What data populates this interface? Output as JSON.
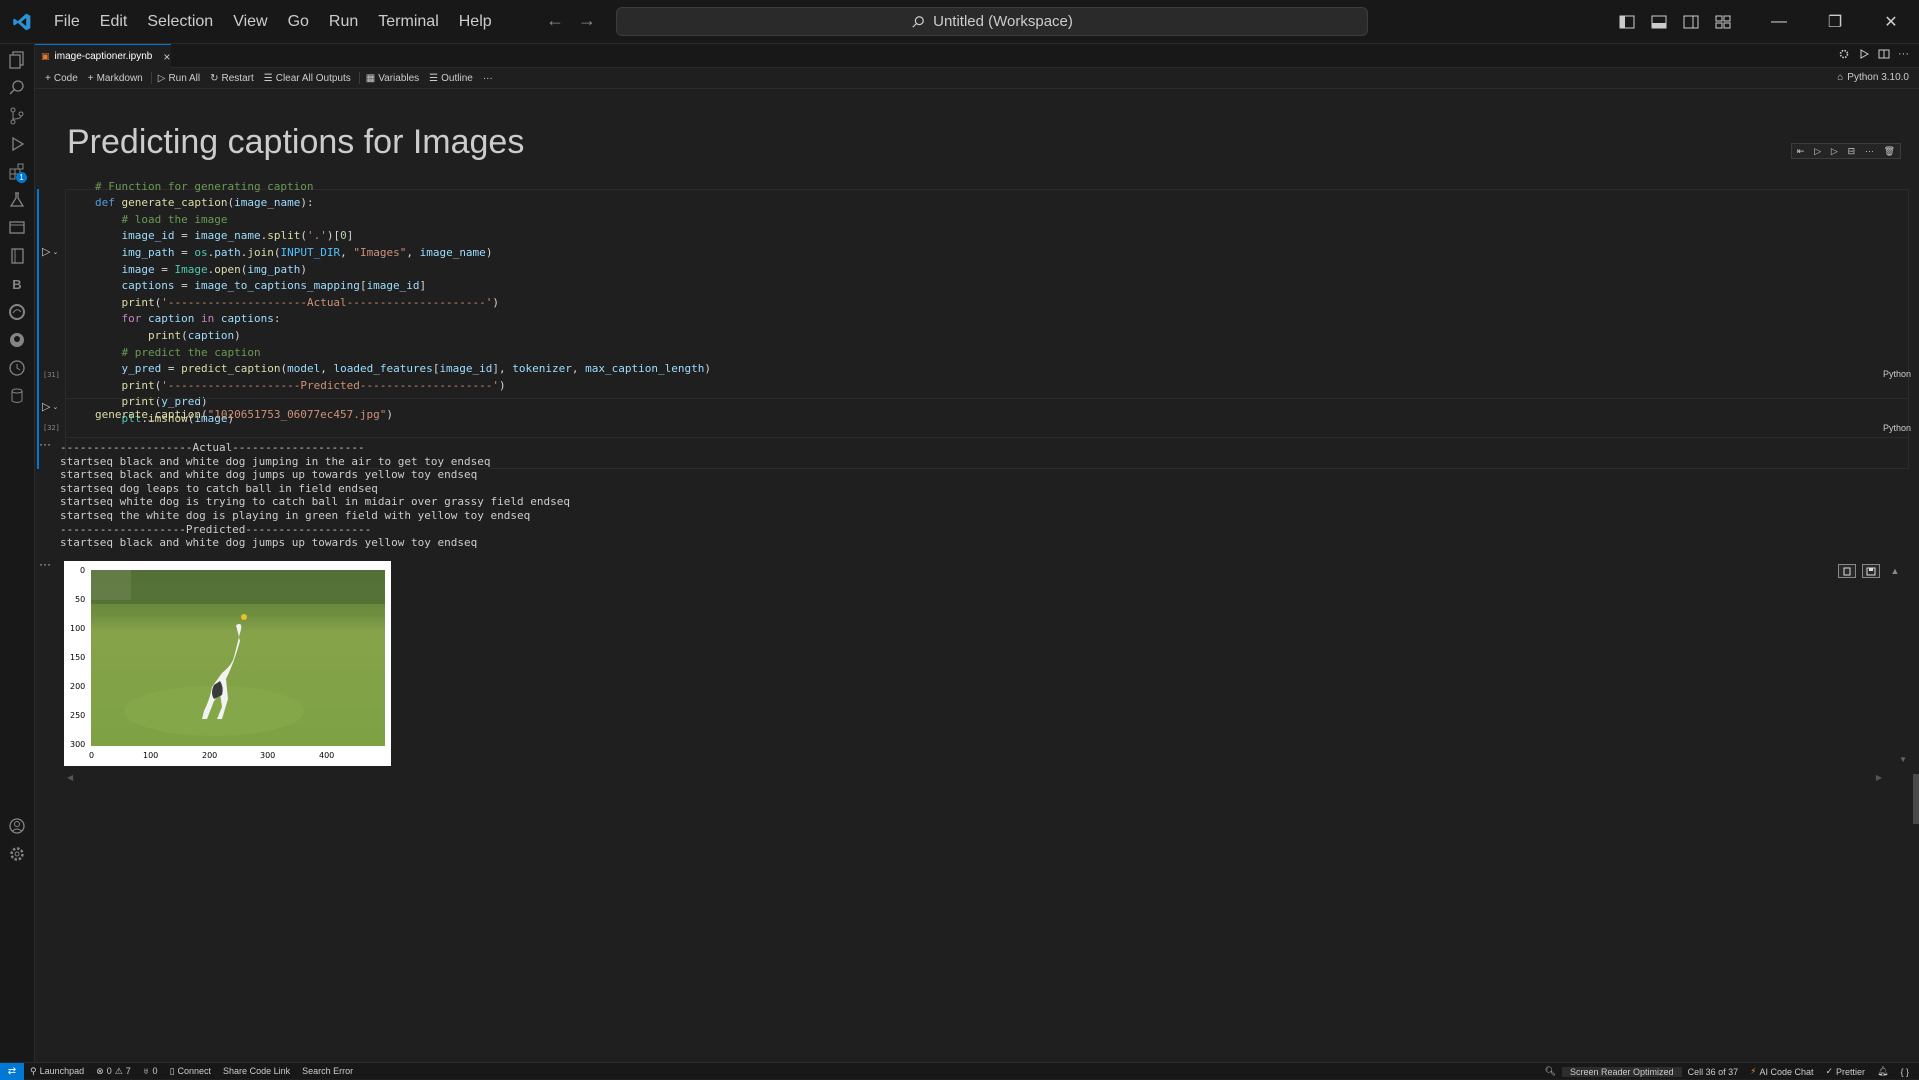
{
  "menu": [
    "File",
    "Edit",
    "Selection",
    "View",
    "Go",
    "Run",
    "Terminal",
    "Help"
  ],
  "command_center": {
    "text": "Untitled (Workspace)"
  },
  "tab": {
    "label": "image-captioner.ipynb"
  },
  "toolbar": {
    "code": "Code",
    "markdown": "Markdown",
    "run_all": "Run All",
    "restart": "Restart",
    "clear_outputs": "Clear All Outputs",
    "variables": "Variables",
    "outline": "Outline",
    "kernel": "Python 3.10.0"
  },
  "notebook": {
    "heading": "Predicting captions for Images",
    "cell1": {
      "exec_count": "[31]",
      "language": "Python",
      "lines": [
        "# Function for generating caption",
        "def generate_caption(image_name):",
        "    # load the image",
        "    image_id = image_name.split('.')[0]",
        "    img_path = os.path.join(INPUT_DIR, \"Images\", image_name)",
        "    image = Image.open(img_path)",
        "    captions = image_to_captions_mapping[image_id]",
        "    print('---------------------Actual---------------------')",
        "    for caption in captions:",
        "        print(caption)",
        "    # predict the caption",
        "    y_pred = predict_caption(model, loaded_features[image_id], tokenizer, max_caption_length)",
        "    print('--------------------Predicted--------------------')",
        "    print(y_pred)",
        "    plt.imshow(image)"
      ]
    },
    "cell2": {
      "exec_count": "[32]",
      "language": "Python",
      "code": "generate_caption(\"1020651753_06077ec457.jpg\")"
    },
    "output_lines": [
      "--------------------Actual--------------------",
      "startseq black and white dog jumping in the air to get toy endseq",
      "startseq black and white dog jumps up towards yellow toy endseq",
      "startseq dog leaps to catch ball in field endseq",
      "startseq white dog is trying to catch ball in midair over grassy field endseq",
      "startseq the white dog is playing in green field with yellow toy endseq",
      "-------------------Predicted-------------------",
      "startseq black and white dog jumps up towards yellow toy endseq"
    ],
    "plot": {
      "x_ticks": [
        "0",
        "100",
        "200",
        "300",
        "400"
      ],
      "y_ticks": [
        "0",
        "50",
        "100",
        "150",
        "200",
        "250",
        "300"
      ]
    }
  },
  "statusbar": {
    "launchpad": "Launchpad",
    "errors": "0",
    "warnings": "7",
    "ports": "0",
    "connect": "Connect",
    "share": "Share Code Link",
    "search_error": "Search Error",
    "screen_reader": "Screen Reader Optimized",
    "cell_pos": "Cell 36 of 37",
    "ai_chat": "AI Code Chat",
    "prettier": "Prettier"
  }
}
